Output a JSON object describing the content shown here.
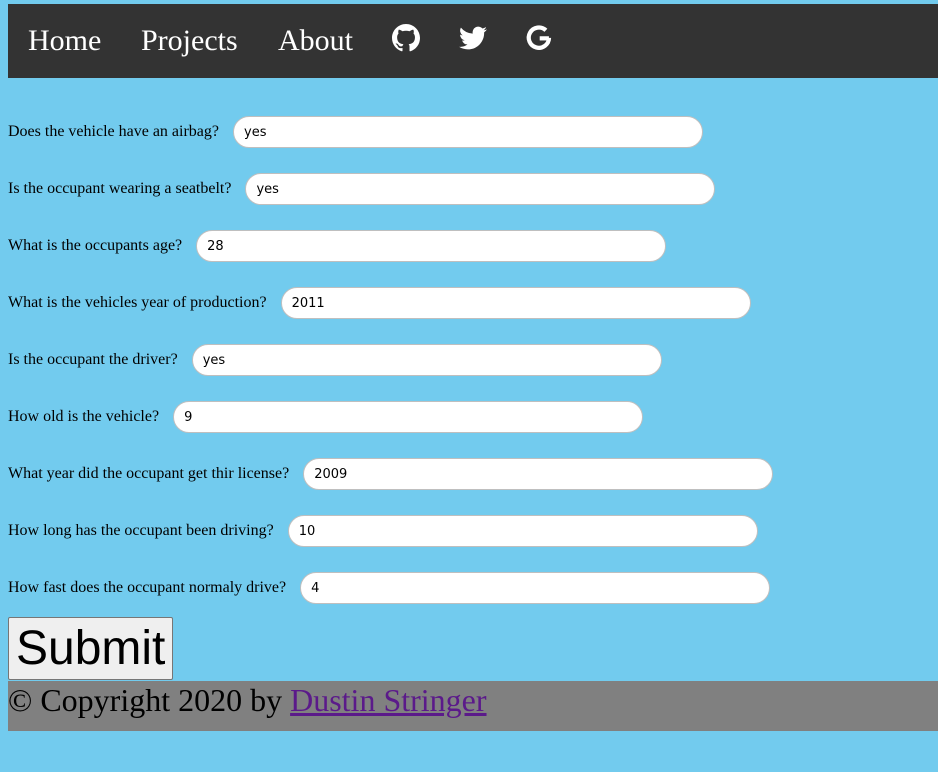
{
  "nav": {
    "home": "Home",
    "projects": "Projects",
    "about": "About",
    "icons": [
      "github-icon",
      "twitter-icon",
      "google-icon"
    ]
  },
  "form": {
    "fields": [
      {
        "label": "Does the vehicle have an airbag?",
        "value": "yes"
      },
      {
        "label": "Is the occupant wearing a seatbelt?",
        "value": "yes"
      },
      {
        "label": "What is the occupants age?",
        "value": "28"
      },
      {
        "label": "What is the vehicles year of production?",
        "value": "2011"
      },
      {
        "label": "Is the occupant the driver?",
        "value": "yes"
      },
      {
        "label": "How old is the vehicle?",
        "value": "9"
      },
      {
        "label": "What year did the occupant get thir license?",
        "value": "2009"
      },
      {
        "label": "How long has the occupant been driving?",
        "value": "10"
      },
      {
        "label": "How fast does the occupant normaly drive?",
        "value": "4"
      }
    ],
    "submit_label": "Submit"
  },
  "footer": {
    "copyright": "© Copyright 2020 by ",
    "author": "Dustin Stringer"
  },
  "colors": {
    "background": "#72cbee",
    "navbar": "#333333",
    "footer": "#808080",
    "link_visited": "#5b1a8a"
  }
}
